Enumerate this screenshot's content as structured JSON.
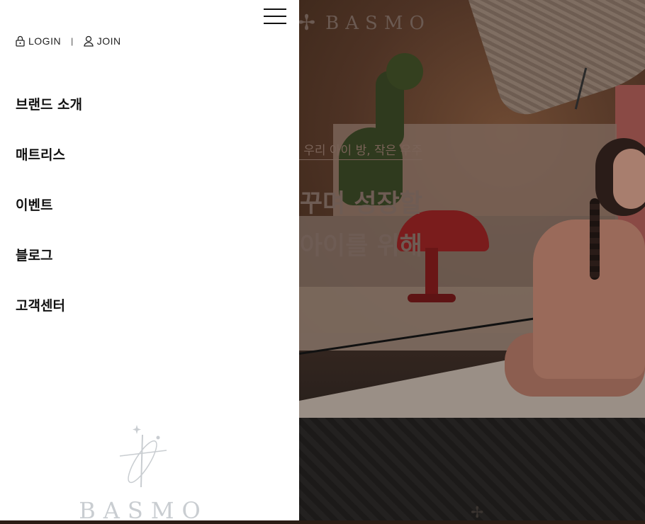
{
  "drawer": {
    "auth": {
      "login_label": "LOGIN",
      "separator": "|",
      "join_label": "JOIN",
      "login_icon": "lock-icon",
      "join_icon": "user-icon"
    },
    "menu_toggle_icon": "hamburger-icon",
    "nav": [
      {
        "label": "브랜드 소개"
      },
      {
        "label": "매트리스"
      },
      {
        "label": "이벤트"
      },
      {
        "label": "블로그"
      },
      {
        "label": "고객센터"
      }
    ],
    "footer_logo": {
      "wordmark": "BASMO",
      "icon": "star-orbit-icon"
    }
  },
  "hero": {
    "logo": {
      "wordmark": "BASMO",
      "icon": "star-orbit-icon"
    },
    "kicker": "우리 아이 방, 작은 우주",
    "headline_line1": "꾸며 성장할",
    "headline_line2": "아이를 위해"
  },
  "colors": {
    "drawer_bg": "#ffffff",
    "nav_text": "#111111",
    "logo_gray": "#c9cdd1",
    "hero_overlay_text": "#6e5c54"
  }
}
